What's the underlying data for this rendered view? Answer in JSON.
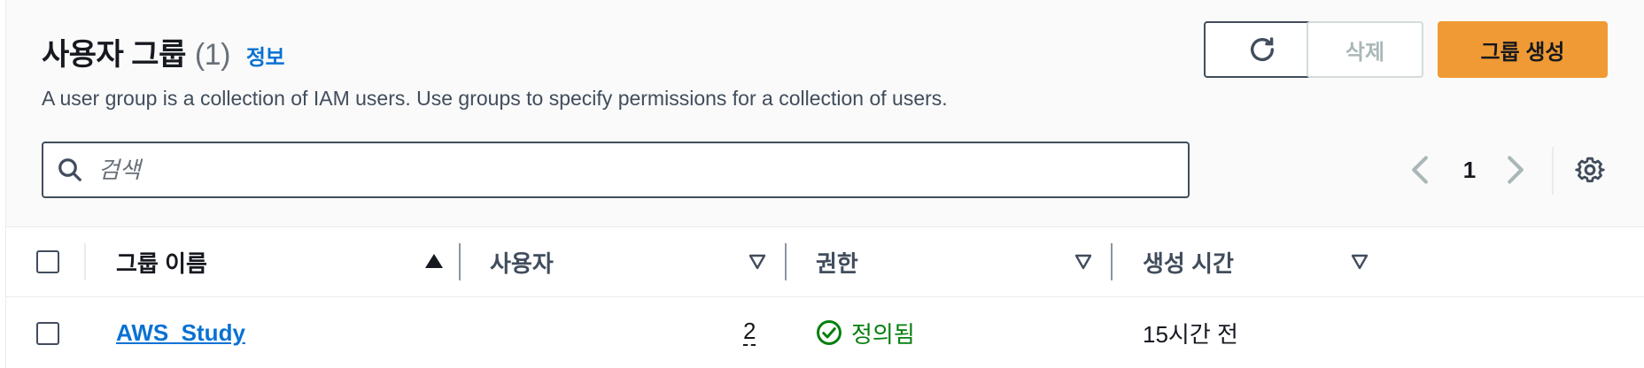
{
  "header": {
    "title": "사용자 그룹",
    "count": "(1)",
    "info_link": "정보",
    "description": "A user group is a collection of IAM users. Use groups to specify permissions for a collection of users."
  },
  "actions": {
    "delete_label": "삭제",
    "create_label": "그룹 생성"
  },
  "search": {
    "placeholder": "검색"
  },
  "pagination": {
    "current_page": "1"
  },
  "table": {
    "columns": {
      "group_name": "그룹 이름",
      "users": "사용자",
      "permissions": "권한",
      "created": "생성 시간"
    },
    "rows": [
      {
        "group_name": "AWS_Study",
        "users": "2",
        "permissions": "정의됨",
        "created": "15시간 전"
      }
    ]
  },
  "colors": {
    "primary_button": "#f09a35",
    "link": "#0972d3",
    "success": "#037f0c"
  },
  "icons": [
    "refresh-icon",
    "search-icon",
    "chevron-left-icon",
    "chevron-right-icon",
    "settings-gear-icon",
    "sort-ascending-icon",
    "sort-descending-icon",
    "check-circle-icon"
  ]
}
